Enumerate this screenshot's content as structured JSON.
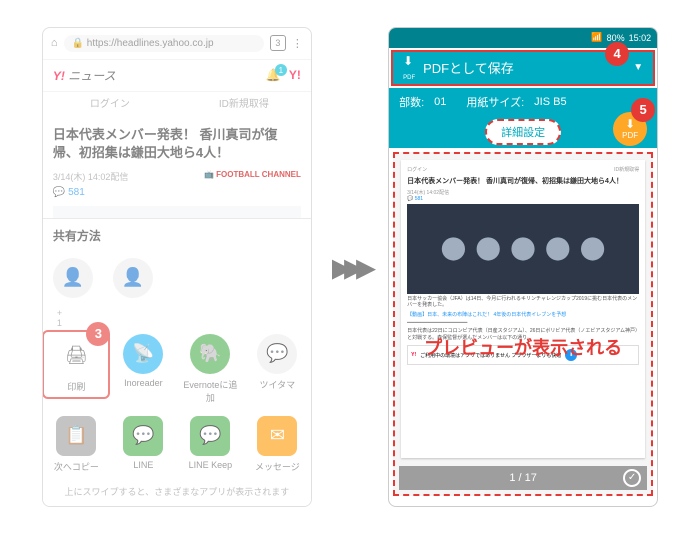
{
  "left": {
    "url": "https://headlines.yahoo.co.jp",
    "tab_count": "3",
    "brand": "Y!",
    "brand_sub": "ニュース",
    "tabs": {
      "login": "ログイン",
      "register": "ID新規取得"
    },
    "article": {
      "title": "日本代表メンバー発表！ 香川真司が復帰、初招集は鎌田大地ら4人！",
      "date": "3/14(木) 14:02配信",
      "source": "FOOTBALL CHANNEL",
      "comments": "581"
    },
    "share": {
      "title": "共有方法",
      "count": "1",
      "items": [
        {
          "label": "印刷",
          "icon": "🖨"
        },
        {
          "label": "Inoreader",
          "icon": "📡"
        },
        {
          "label": "Evernoteに追加",
          "icon": "🐘"
        },
        {
          "label": "ツイタマ",
          "icon": "💬"
        }
      ],
      "row2": [
        {
          "label": "次へコピー",
          "icon": "📋"
        },
        {
          "label": "LINE",
          "icon": "💬"
        },
        {
          "label": "LINE Keep",
          "icon": "💬"
        },
        {
          "label": "メッセージ",
          "icon": "✉"
        }
      ],
      "footer": "上にスワイプすると、さまざまなアプリが表示されます"
    }
  },
  "right": {
    "status": {
      "signal": "📶",
      "battery": "80%",
      "time": "15:02"
    },
    "pdf_label": "PDFとして保存",
    "copies_label": "部数:",
    "copies": "01",
    "paper_label": "用紙サイズ:",
    "paper": "JIS B5",
    "detail": "詳細設定",
    "fab": "PDF",
    "preview": {
      "tabs": {
        "login": "ログイン",
        "register": "ID新規取得"
      },
      "title": "日本代表メンバー発表！ 香川真司が復帰、初招集は鎌田大地ら4人！",
      "date": "3/14(木) 14:02配信",
      "comments": "581",
      "body1": "日本サッカー協会（JFA）は14日、今月に行われるキリンチャレンジカップ2019に挑む日本代表のメンバーを発表した。",
      "link": "【動画】日本、未来の布陣はこれだ！ 4年後の日本代表イレブンを予想",
      "body2": "日本代表は22日にコロンビア代表（日産スタジアム）、26日にボリビア代表（ノエビアスタジアム神戸）と対戦する。森保監督が選んだメンバーは以下の通り。",
      "label": "プレビューが表示される"
    },
    "page": "1 / 17"
  },
  "badges": {
    "b3": "3",
    "b4": "4",
    "b5": "5"
  }
}
